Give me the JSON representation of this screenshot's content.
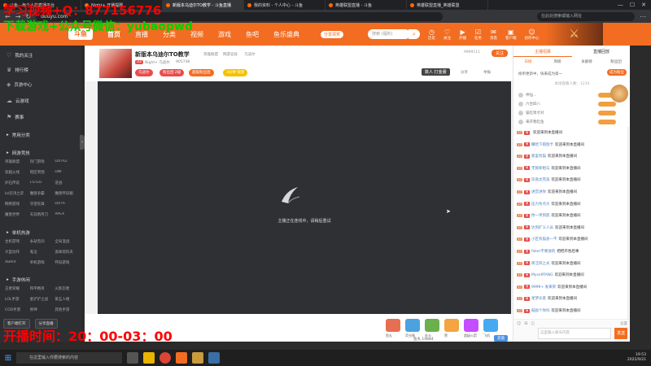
{
  "browser": {
    "tabs": [
      {
        "label": "斗鱼 - 每个人的直播平台",
        "active": false
      },
      {
        "label": "Night+ 开播提醒",
        "active": false
      },
      {
        "label": "新版本乌迪尔TO教学 - 斗鱼直播",
        "active": true
      },
      {
        "label": "我的资料 - 个人中心 - 斗鱼",
        "active": false
      },
      {
        "label": "英雄联盟直播 - 斗鱼",
        "active": false
      },
      {
        "label": "英雄联盟直播_英雄联盟",
        "active": false
      }
    ],
    "url": "douyu.com",
    "search_placeholder": "在此处搜索或输入网址"
  },
  "overlays": {
    "line1": "学习视频+Q：877156776",
    "line2": "下载游戏+公众号微信：yubaopwd",
    "line3": "开播时间：20：00-03：00"
  },
  "header": {
    "logo": "斗鱼",
    "nav": [
      "首页",
      "直播",
      "分类",
      "视频",
      "游戏",
      "鱼吧",
      "鱼乐盛典"
    ],
    "download_label": "分享领奖",
    "search_placeholder": "搜索 (福利)",
    "icons": [
      {
        "name": "history",
        "label": "历史",
        "glyph": "◷"
      },
      {
        "name": "follow",
        "label": "关注",
        "glyph": "♡"
      },
      {
        "name": "broadcast",
        "label": "开播",
        "glyph": "▶"
      },
      {
        "name": "task",
        "label": "任务",
        "glyph": "☑"
      },
      {
        "name": "messages",
        "label": "消息",
        "glyph": "✉"
      },
      {
        "name": "creator",
        "label": "客户端",
        "glyph": "▣"
      },
      {
        "name": "user",
        "label": "创作中心",
        "glyph": "☺"
      }
    ]
  },
  "sidebar": {
    "items": [
      {
        "label": "我的关注",
        "icon": "♡"
      },
      {
        "label": "排行榜",
        "icon": "♛"
      },
      {
        "label": "页游中心",
        "icon": "◈"
      },
      {
        "label": "云游戏",
        "icon": "☁"
      },
      {
        "label": "赛事",
        "icon": "⚑"
      }
    ],
    "sections": [
      {
        "label": "常用分类"
      },
      {
        "label": "网游竞技",
        "games": [
          "英雄联盟",
          "热门游戏",
          "DOTA2",
          "穿越火线",
          "暗区突围",
          "DNF",
          "炉石传说",
          "CS:GO",
          "逆战",
          "lol云顶之弈",
          "魔兽争霸",
          "魔兽怀旧服",
          "网络游戏",
          "守望先锋",
          "DOTA",
          "魔兽世界",
          "天涯明月刀",
          "APEX"
        ]
      },
      {
        "label": "单机热游",
        "games": [
          "主机游戏",
          "永劫无间",
          "全局混战",
          "大型动作",
          "鬼泣",
          "逃离塔科夫",
          "XBAIX",
          "单机游戏",
          "怀旧游戏"
        ]
      },
      {
        "label": "手游休闲",
        "games": [
          "王者荣耀",
          "和平精英",
          "火影忍者",
          "LOL手游",
          "金铲铲之战",
          "第五人格",
          "COD手游",
          "原神",
          "其他手游"
        ]
      }
    ],
    "bottom_buttons": [
      "客户端打开",
      "分享直播"
    ]
  },
  "room": {
    "title": "新版本乌迪尔TO教学",
    "tag_game": "英雄联盟",
    "tag_extra": "网游竞技",
    "tag_sub": "乌迪尔",
    "streamer": "Night+ 乌迪尔",
    "level": "33",
    "followers": "905748",
    "room_id": "9999111",
    "follow_label": "关注",
    "report_label": "举报",
    "pills": [
      {
        "label": "乌迪尔",
        "color": "#e84d4d"
      },
      {
        "label": "粉丝团 2级",
        "color": "#e84d4d"
      },
      {
        "label": "超级粉丝团",
        "color": "#f26d21"
      },
      {
        "label": "3分钟 快速",
        "color": "#f5c000"
      }
    ],
    "pk_label": "数人 打金服",
    "share_label": "分享",
    "lang_label": "客户端",
    "video_message": "主播正在连线中，请稍后重试"
  },
  "gifts": [
    {
      "label": "鱼丸",
      "color": "#e76f51"
    },
    {
      "label": "荧光棒",
      "color": "#4aa3df"
    },
    {
      "label": "办卡",
      "color": "#6ab04c"
    },
    {
      "label": "赞",
      "color": "#f2a541"
    },
    {
      "label": "超级火箭",
      "color": "#c44dff"
    },
    {
      "label": "飞机",
      "color": "#45aaf2"
    }
  ],
  "gift_count": "鱼丸 14884",
  "charge_label": "充值",
  "right_panel": {
    "tabs": [
      "主播招募",
      "直播回放"
    ],
    "sub_tabs": [
      "日榜",
      "周榜",
      "贡献榜",
      "粉丝团"
    ],
    "note": "榜单更新中，快来成为第一",
    "open_fans_label": "成为粉丝",
    "empty_note": "本场观看人数：1234",
    "rank_rows": [
      "神仙...",
      "六合四八",
      "猫吃草才对",
      "来开我吃鱼"
    ],
    "chat": [
      {
        "lv": "17",
        "nick": "",
        "text": "欢迎来到本直播间"
      },
      {
        "lv": "17",
        "nick": "撒哈下雨刮卡",
        "text": "欢迎来到本直播间"
      },
      {
        "lv": "17",
        "nick": "家里有猫",
        "text": "欢迎来到本直播间"
      },
      {
        "lv": "17",
        "nick": "无限新相与",
        "text": "欢迎来到本直播间"
      },
      {
        "lv": "17",
        "nick": "毕竟太完美",
        "text": "欢迎来到本直播间"
      },
      {
        "lv": "17",
        "nick": "进宫进你",
        "text": "欢迎来到本直播间"
      },
      {
        "lv": "17",
        "nick": "压力有点大",
        "text": "欢迎来到本直播间"
      },
      {
        "lv": "17",
        "nick": "你一单到底",
        "text": "欢迎来到本直播间"
      },
      {
        "lv": "17",
        "nick": "达到扩义人员",
        "text": "欢迎来到本直播间"
      },
      {
        "lv": "17",
        "nick": "小区有猫会一不",
        "text": "欢迎来到本直播间"
      },
      {
        "lv": "17",
        "nick": "faker不要放的",
        "text": "把把开吞后事"
      },
      {
        "lv": "17",
        "nick": "简洁风之光",
        "text": "欢迎来到本直播间"
      },
      {
        "lv": "17",
        "nick": "MyselfFANG",
        "text": "欢迎来到本直播间"
      },
      {
        "lv": "17",
        "nick": "9999+ 发来贺",
        "text": "欢迎来到本直播间"
      },
      {
        "lv": "17",
        "nick": "星梦乐意",
        "text": "欢迎来到本直播间"
      },
      {
        "lv": "17",
        "nick": "鼓励个你吗",
        "text": "欢迎来到本直播间"
      }
    ],
    "input_placeholder": "这里输入聊天内容",
    "send_label": "发送",
    "settings_label": "设置"
  },
  "taskbar": {
    "search_placeholder": "在这里输入你要搜索的内容",
    "time": "19:53",
    "date": "2022/9/21"
  }
}
